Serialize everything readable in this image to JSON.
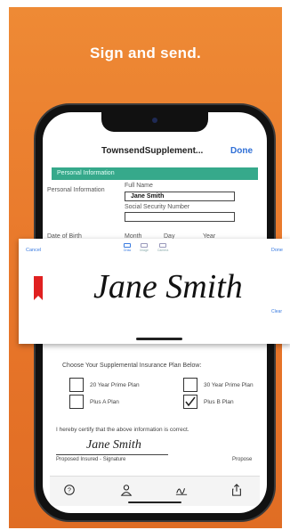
{
  "headline": "Sign and send.",
  "doc": {
    "title": "TownsendSupplement...",
    "done_label": "Done",
    "section_header": "Personal Information",
    "personal_label": "Personal Information",
    "full_name_label": "Full Name",
    "full_name_value": "Jane Smith",
    "ssn_label": "Social Security Number",
    "date_labels": [
      "Date of Birth",
      "Month",
      "Day",
      "Year"
    ]
  },
  "signature_panel": {
    "cancel_label": "Cancel",
    "done_label": "Done",
    "tools": [
      "Draw",
      "Image",
      "Camera"
    ],
    "signature_text": "Jane Smith",
    "clear_label": "Clear"
  },
  "plans": {
    "title": "Choose Your Supplemental Insurance Plan Below:",
    "options": [
      {
        "label": "20 Year Prime Plan",
        "checked": false
      },
      {
        "label": "30 Year Prime Plan",
        "checked": false
      },
      {
        "label": "Plus A Plan",
        "checked": false
      },
      {
        "label": "Plus B Plan",
        "checked": true
      }
    ]
  },
  "certify": {
    "text": "I hereby certify that the above information is correct.",
    "signature_text": "Jane Smith",
    "insured_label": "Proposed Insured - Signature",
    "proposed_label": "Propose"
  },
  "tabbar": [
    "help-icon",
    "person-icon",
    "signature-icon",
    "share-icon"
  ],
  "colors": {
    "background": "#e8762a",
    "section": "#36a98b",
    "accent": "#2f6fd6"
  }
}
